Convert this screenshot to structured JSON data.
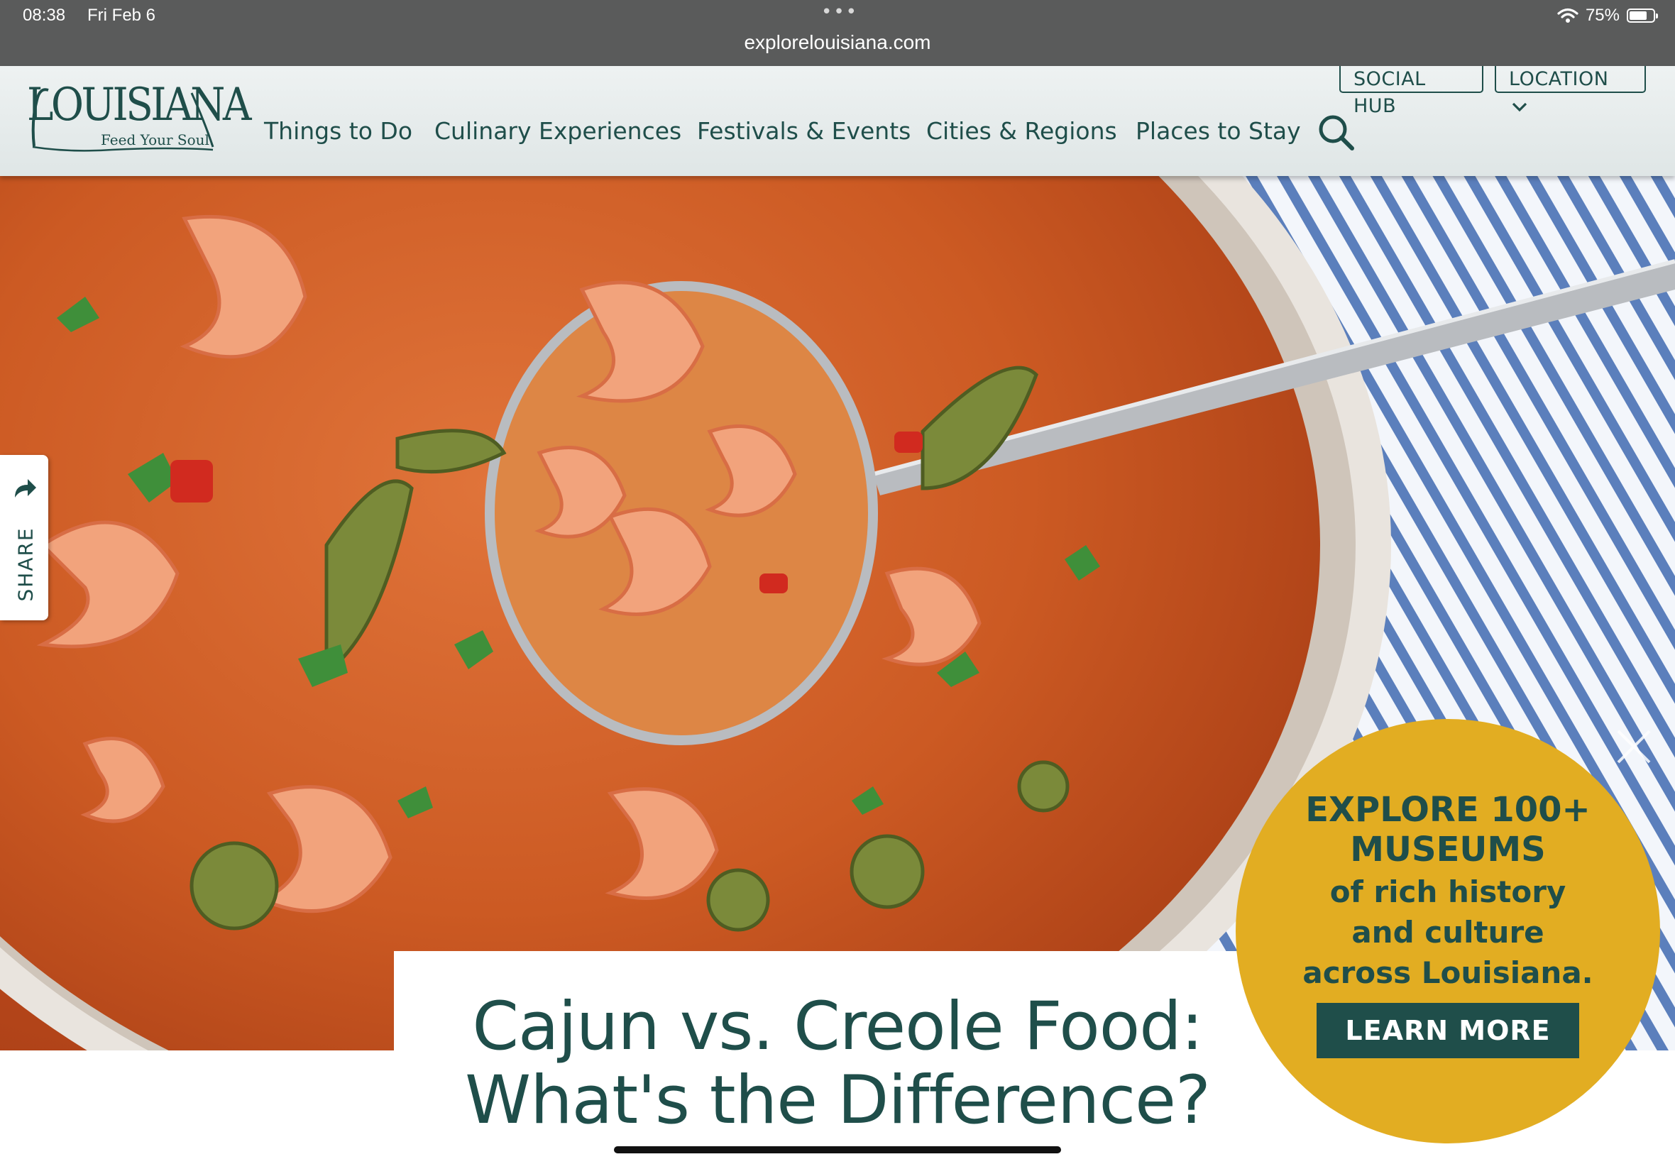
{
  "status_bar": {
    "time": "08:38",
    "date": "Fri Feb 6",
    "dots": "•••",
    "url": "explorelouisiana.com",
    "battery_percent": "75%",
    "battery_level": 0.75
  },
  "header": {
    "logo_text": "LOUISIANA",
    "logo_tagline": "Feed Your Soul.",
    "social_hub_label": "SOCIAL HUB",
    "location_label": "LOCATION",
    "nav": [
      "Things to Do",
      "Culinary Experiences",
      "Festivals & Events",
      "Cities & Regions",
      "Places to Stay"
    ]
  },
  "share": {
    "label": "SHARE"
  },
  "hero": {
    "title_line1": "Cajun vs. Creole Food:",
    "title_line2": "What's the Difference?"
  },
  "promo": {
    "headline_line1": "EXPLORE 100+",
    "headline_line2": "MUSEUMS",
    "sub_line1": "of rich history",
    "sub_line2": "and culture",
    "sub_line3": "across Louisiana.",
    "button_label": "LEARN MORE"
  },
  "colors": {
    "brand_teal": "#1f4e4a",
    "promo_gold": "#e2ad22",
    "status_bar": "#5a5b5b"
  },
  "icons": [
    "wifi-icon",
    "battery-icon",
    "search-icon",
    "chevron-down-icon",
    "share-arrow-icon",
    "close-icon"
  ]
}
